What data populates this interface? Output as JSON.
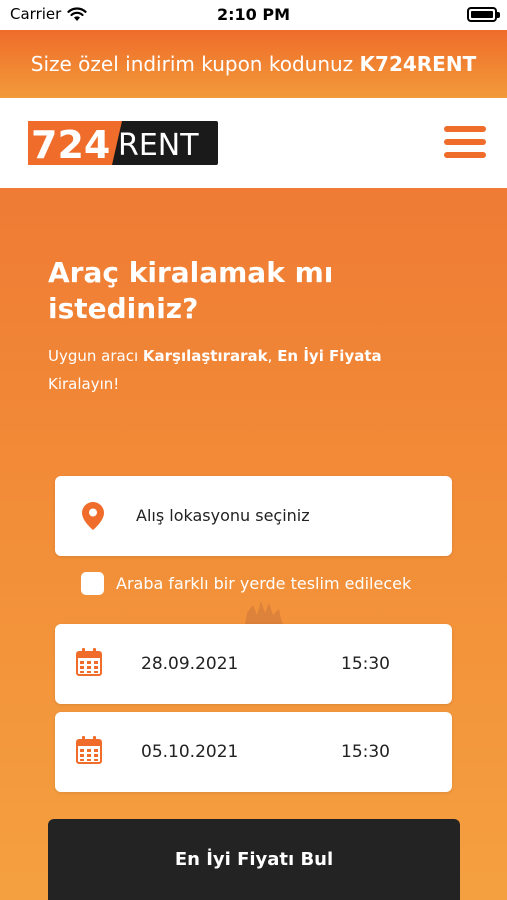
{
  "status_bar": {
    "carrier": "Carrier",
    "time": "2:10 PM"
  },
  "promo": {
    "text": "Size özel indirim kupon kodunuz",
    "code": "K724RENT"
  },
  "header": {
    "logo_text": "724RENT",
    "brand_color": "#ef6c2a"
  },
  "hero": {
    "headline": "Araç kiralamak mı istediniz?",
    "sub_part1": "Uygun aracı ",
    "sub_bold1": "Karşılaştırarak",
    "sub_part2": ", ",
    "sub_bold2": "En İyi Fiyata",
    "sub_part3": " Kiralayın!"
  },
  "form": {
    "location_placeholder": "Alış lokasyonu seçiniz",
    "different_dropoff_label": "Araba farklı bir yerde teslim edilecek",
    "pickup": {
      "date": "28.09.2021",
      "time": "15:30"
    },
    "return": {
      "date": "05.10.2021",
      "time": "15:30"
    },
    "submit_label": "En İyi Fiyatı Bul"
  },
  "icons": [
    "wifi-icon",
    "battery-icon",
    "menu-icon",
    "location-pin-icon",
    "calendar-icon"
  ]
}
